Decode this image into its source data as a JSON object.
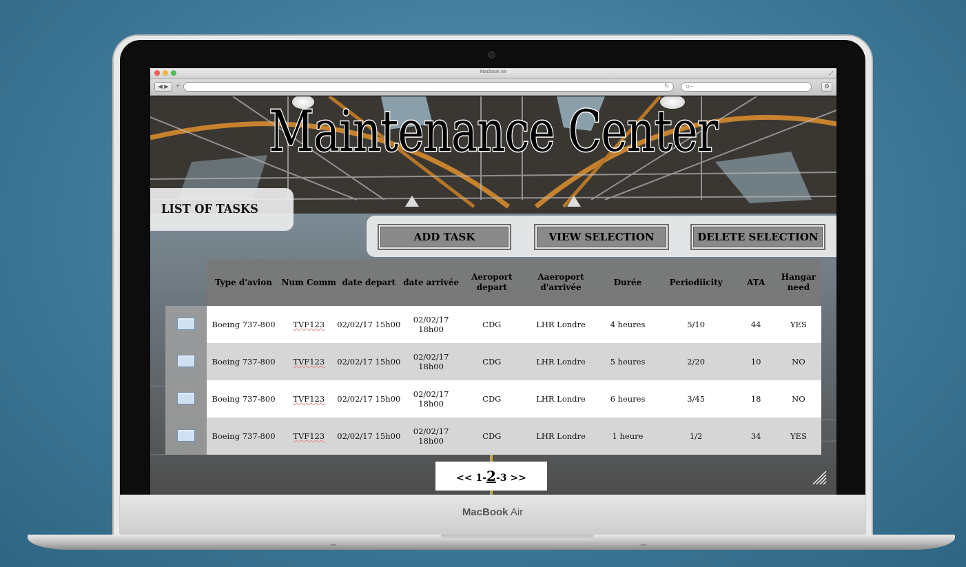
{
  "device": {
    "brand": "MacBook",
    "model": "Air"
  },
  "browser": {
    "window_title": "Macbook Air",
    "back_label": "◀ ▶",
    "add_tab_label": "+",
    "reload_icon": "reload-icon",
    "search_placeholder": "Q~",
    "settings_icon": "gear-icon"
  },
  "page": {
    "title": "Maintenance Center",
    "section_title": "LIST OF TASKS",
    "actions": {
      "add": "ADD TASK",
      "view": "VIEW SELECTION",
      "delete": "DELETE SELECTION"
    },
    "table": {
      "headers": [
        "Type d'avion",
        "Num Comm",
        "date depart",
        "date arrivée",
        "Aeroport depart",
        "Aaeroport d'arrivée",
        "Durée",
        "Periodiicity",
        "ATA",
        "Hangar need"
      ],
      "rows": [
        {
          "type": "Boeing 737-800",
          "num": "TVF123",
          "dep": "02/02/17 15h00",
          "arr": "02/02/17 18h00",
          "ap_dep": "CDG",
          "ap_arr": "LHR Londre",
          "duree": "4 heures",
          "period": "5/10",
          "ata": "44",
          "hangar": "YES"
        },
        {
          "type": "Boeing 737-800",
          "num": "TVF123",
          "dep": "02/02/17 15h00",
          "arr": "02/02/17 18h00",
          "ap_dep": "CDG",
          "ap_arr": "LHR Londre",
          "duree": "5 heures",
          "period": "2/20",
          "ata": "10",
          "hangar": "NO"
        },
        {
          "type": "Boeing 737-800",
          "num": "TVF123",
          "dep": "02/02/17 15h00",
          "arr": "02/02/17 18h00",
          "ap_dep": "CDG",
          "ap_arr": "LHR Londre",
          "duree": "6 heures",
          "period": "3/45",
          "ata": "18",
          "hangar": "NO"
        },
        {
          "type": "Boeing 737-800",
          "num": "TVF123",
          "dep": "02/02/17 15h00",
          "arr": "02/02/17 18h00",
          "ap_dep": "CDG",
          "ap_arr": "LHR Londre",
          "duree": "1 heure",
          "period": "1/2",
          "ata": "34",
          "hangar": "YES"
        }
      ]
    },
    "pagination": {
      "prev": "<<",
      "pages": [
        "1",
        "2",
        "3"
      ],
      "current": "2",
      "next": ">>",
      "separator": "-"
    }
  },
  "colors": {
    "background": "#4a87a6",
    "header_row": "#787878",
    "row_white": "#ffffff",
    "row_gray": "#d6d6d6",
    "button": "#8a8a8a",
    "checkbox": "#cfe0f3"
  }
}
